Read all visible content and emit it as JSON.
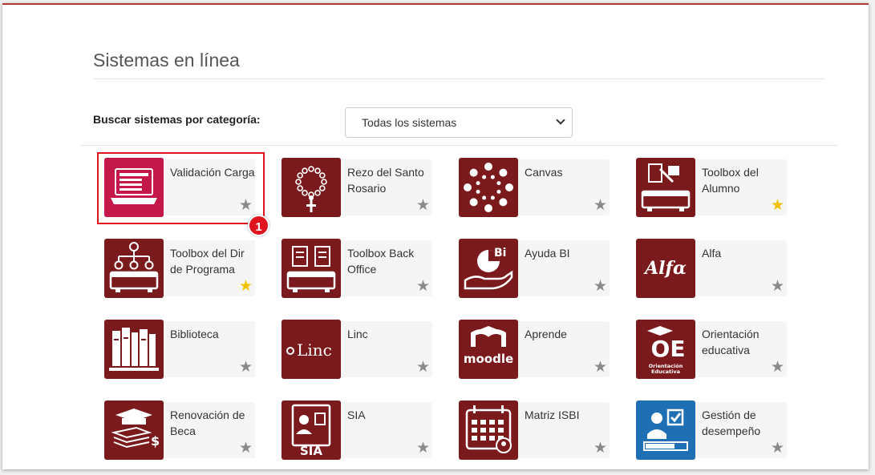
{
  "page": {
    "title": "Sistemas en línea",
    "filter_label": "Buscar sistemas por categoría:",
    "filter_selected": "Todas los sistemas"
  },
  "callout": {
    "number": "1"
  },
  "cards": [
    {
      "name": "Validación Carga",
      "icon": "laptop-form-icon",
      "favorite": false
    },
    {
      "name": "Rezo del Santo Rosario",
      "icon": "rosary-icon",
      "favorite": false
    },
    {
      "name": "Canvas",
      "icon": "canvas-logo-icon",
      "favorite": false
    },
    {
      "name": "Toolbox del Alumno",
      "icon": "toolbox-student-icon",
      "favorite": true
    },
    {
      "name": "Toolbox del Dir de Programa",
      "icon": "toolbox-director-icon",
      "favorite": true
    },
    {
      "name": "Toolbox Back Office",
      "icon": "toolbox-backoffice-icon",
      "favorite": false
    },
    {
      "name": "Ayuda BI",
      "icon": "bi-chart-hand-icon",
      "favorite": false
    },
    {
      "name": "Alfa",
      "icon": "alfa-logo-icon",
      "favorite": false,
      "logo_text": "Alfα"
    },
    {
      "name": "Biblioteca",
      "icon": "books-icon",
      "favorite": false
    },
    {
      "name": "Linc",
      "icon": "linc-logo-icon",
      "favorite": false,
      "logo_text": "Linc"
    },
    {
      "name": "Aprende",
      "icon": "moodle-logo-icon",
      "favorite": false,
      "logo_text": "moodle"
    },
    {
      "name": "Orientación educativa",
      "icon": "oe-logo-icon",
      "favorite": false,
      "logo_text": "OE",
      "logo_sub": "Orientación Educativa"
    },
    {
      "name": "Renovación de Beca",
      "icon": "graduation-money-icon",
      "favorite": false
    },
    {
      "name": "SIA",
      "icon": "sia-id-card-icon",
      "favorite": false,
      "logo_text": "SIA"
    },
    {
      "name": "Matriz ISBI",
      "icon": "calendar-matrix-icon",
      "favorite": false
    },
    {
      "name": "Gestión de desempeño",
      "icon": "performance-checkbox-icon",
      "favorite": false,
      "logo_color": "#1f6fb5"
    }
  ],
  "colors": {
    "logo_bg": "#7b1a1d",
    "star_fav": "#f2c200",
    "star_default": "#8a8a8a",
    "highlight": "#e0141e"
  }
}
